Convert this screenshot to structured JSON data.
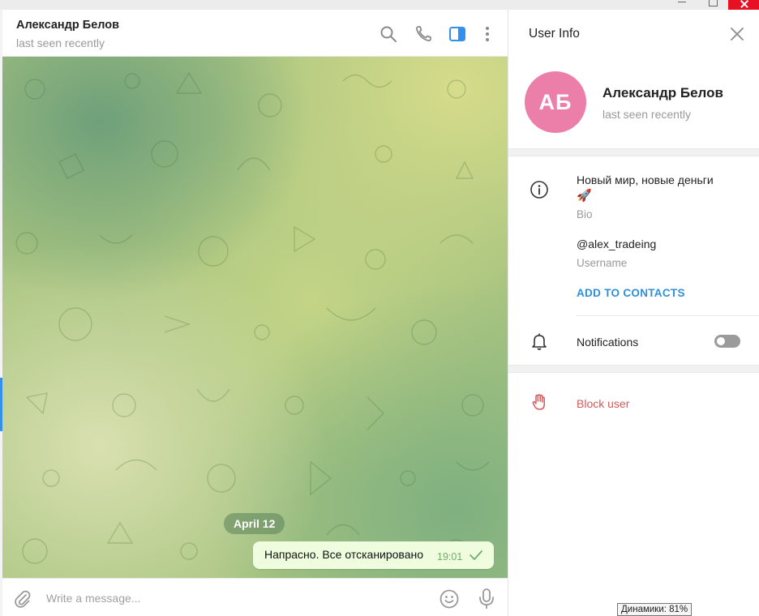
{
  "chat": {
    "name": "Александр Белов",
    "status": "last seen recently",
    "date_separator": "April 12",
    "message": {
      "text": "Напрасно. Все отсканировано",
      "time": "19:01"
    },
    "composer_placeholder": "Write a message..."
  },
  "icons": {
    "search": "search-icon",
    "call": "phone-icon",
    "sidebar": "sidebar-toggle-icon",
    "more": "more-vertical-icon",
    "attach": "paperclip-icon",
    "emoji": "emoji-icon",
    "mic": "microphone-icon"
  },
  "info": {
    "title": "User Info",
    "avatar_initials": "АБ",
    "name": "Александр Белов",
    "status": "last seen recently",
    "bio": "Новый мир, новые деньги",
    "bio_emoji": "🚀",
    "bio_label": "Bio",
    "username": "@alex_tradeing",
    "username_label": "Username",
    "add_contacts": "ADD TO CONTACTS",
    "notifications_label": "Notifications",
    "notifications_enabled": false,
    "block_label": "Block user"
  },
  "tooltip": "Динамики: 81%",
  "colors": {
    "accent": "#3390ec",
    "avatar": "#ec7fa9",
    "link": "#2f8fd8",
    "danger": "#d55a5a",
    "bubble": "#effdde"
  }
}
